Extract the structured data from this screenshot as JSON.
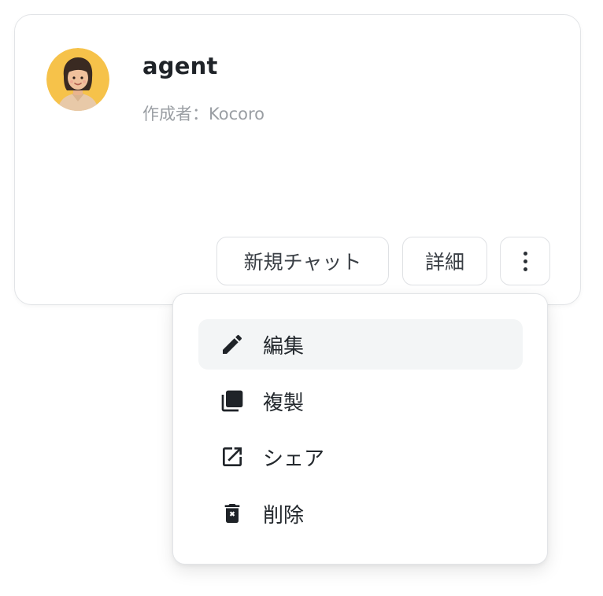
{
  "agent_card": {
    "name": "agent",
    "creator": "作成者：Kocoro",
    "avatar_icon": "person-avatar-icon",
    "buttons": {
      "new_chat": "新規チャット",
      "detail": "詳細",
      "more_icon": "more-vertical-icon"
    }
  },
  "context_menu": {
    "items": [
      {
        "label": "編集",
        "icon": "pencil-icon"
      },
      {
        "label": "複製",
        "icon": "copy-icon"
      },
      {
        "label": "シェア",
        "icon": "open-external-icon"
      },
      {
        "label": "削除",
        "icon": "trash-icon"
      }
    ]
  },
  "colors": {
    "border": "#e2e4e7",
    "muted_text": "#9a9ea3",
    "hover_bg": "#f3f5f6",
    "avatar_bg": "#f6c24a"
  }
}
